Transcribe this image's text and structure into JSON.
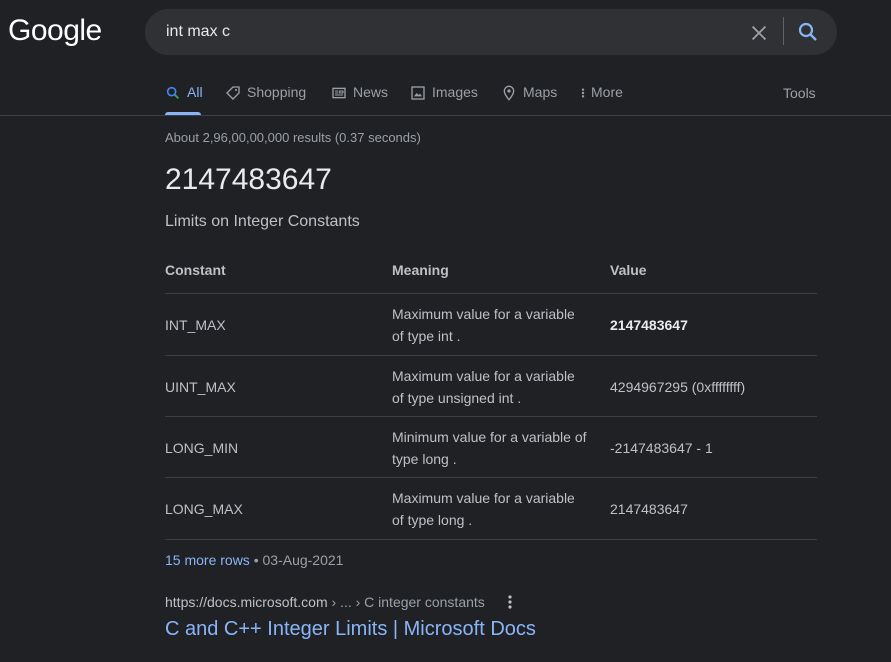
{
  "logo": "Google",
  "search": {
    "query": "int max c"
  },
  "tabs": [
    {
      "label": "All",
      "icon": "search-icon"
    },
    {
      "label": "Shopping",
      "icon": "tag-icon"
    },
    {
      "label": "News",
      "icon": "news-icon"
    },
    {
      "label": "Images",
      "icon": "image-icon"
    },
    {
      "label": "Maps",
      "icon": "map-pin-icon"
    },
    {
      "label": "More",
      "icon": "more-vert-icon"
    }
  ],
  "tools_label": "Tools",
  "stats": "About 2,96,00,00,000 results (0.37 seconds)",
  "answer": "2147483647",
  "subtitle": "Limits on Integer Constants",
  "table": {
    "headers": [
      "Constant",
      "Meaning",
      "Value"
    ],
    "rows": [
      {
        "constant": "INT_MAX",
        "meaning_line1": "Maximum value for a variable",
        "meaning_line2": "of type int .",
        "value": "2147483647"
      },
      {
        "constant": "UINT_MAX",
        "meaning_line1": "Maximum value for a variable",
        "meaning_line2": "of type unsigned int .",
        "value": "4294967295 (0xffffffff)"
      },
      {
        "constant": "LONG_MIN",
        "meaning_line1": "Minimum value for a variable of",
        "meaning_line2": "type long .",
        "value": "-2147483647 - 1"
      },
      {
        "constant": "LONG_MAX",
        "meaning_line1": "Maximum value for a variable",
        "meaning_line2": "of type long .",
        "value": "2147483647"
      }
    ]
  },
  "more_rows": {
    "link": "15 more rows",
    "separator": " • ",
    "date": "03-Aug-2021"
  },
  "result": {
    "url_domain": "https://docs.microsoft.com",
    "url_crumbs": " › ... › C integer constants",
    "title": "C and C++ Integer Limits | Microsoft Docs"
  },
  "colors": {
    "background": "#202124",
    "link": "#8ab4f8",
    "text": "#bdc1c6"
  }
}
